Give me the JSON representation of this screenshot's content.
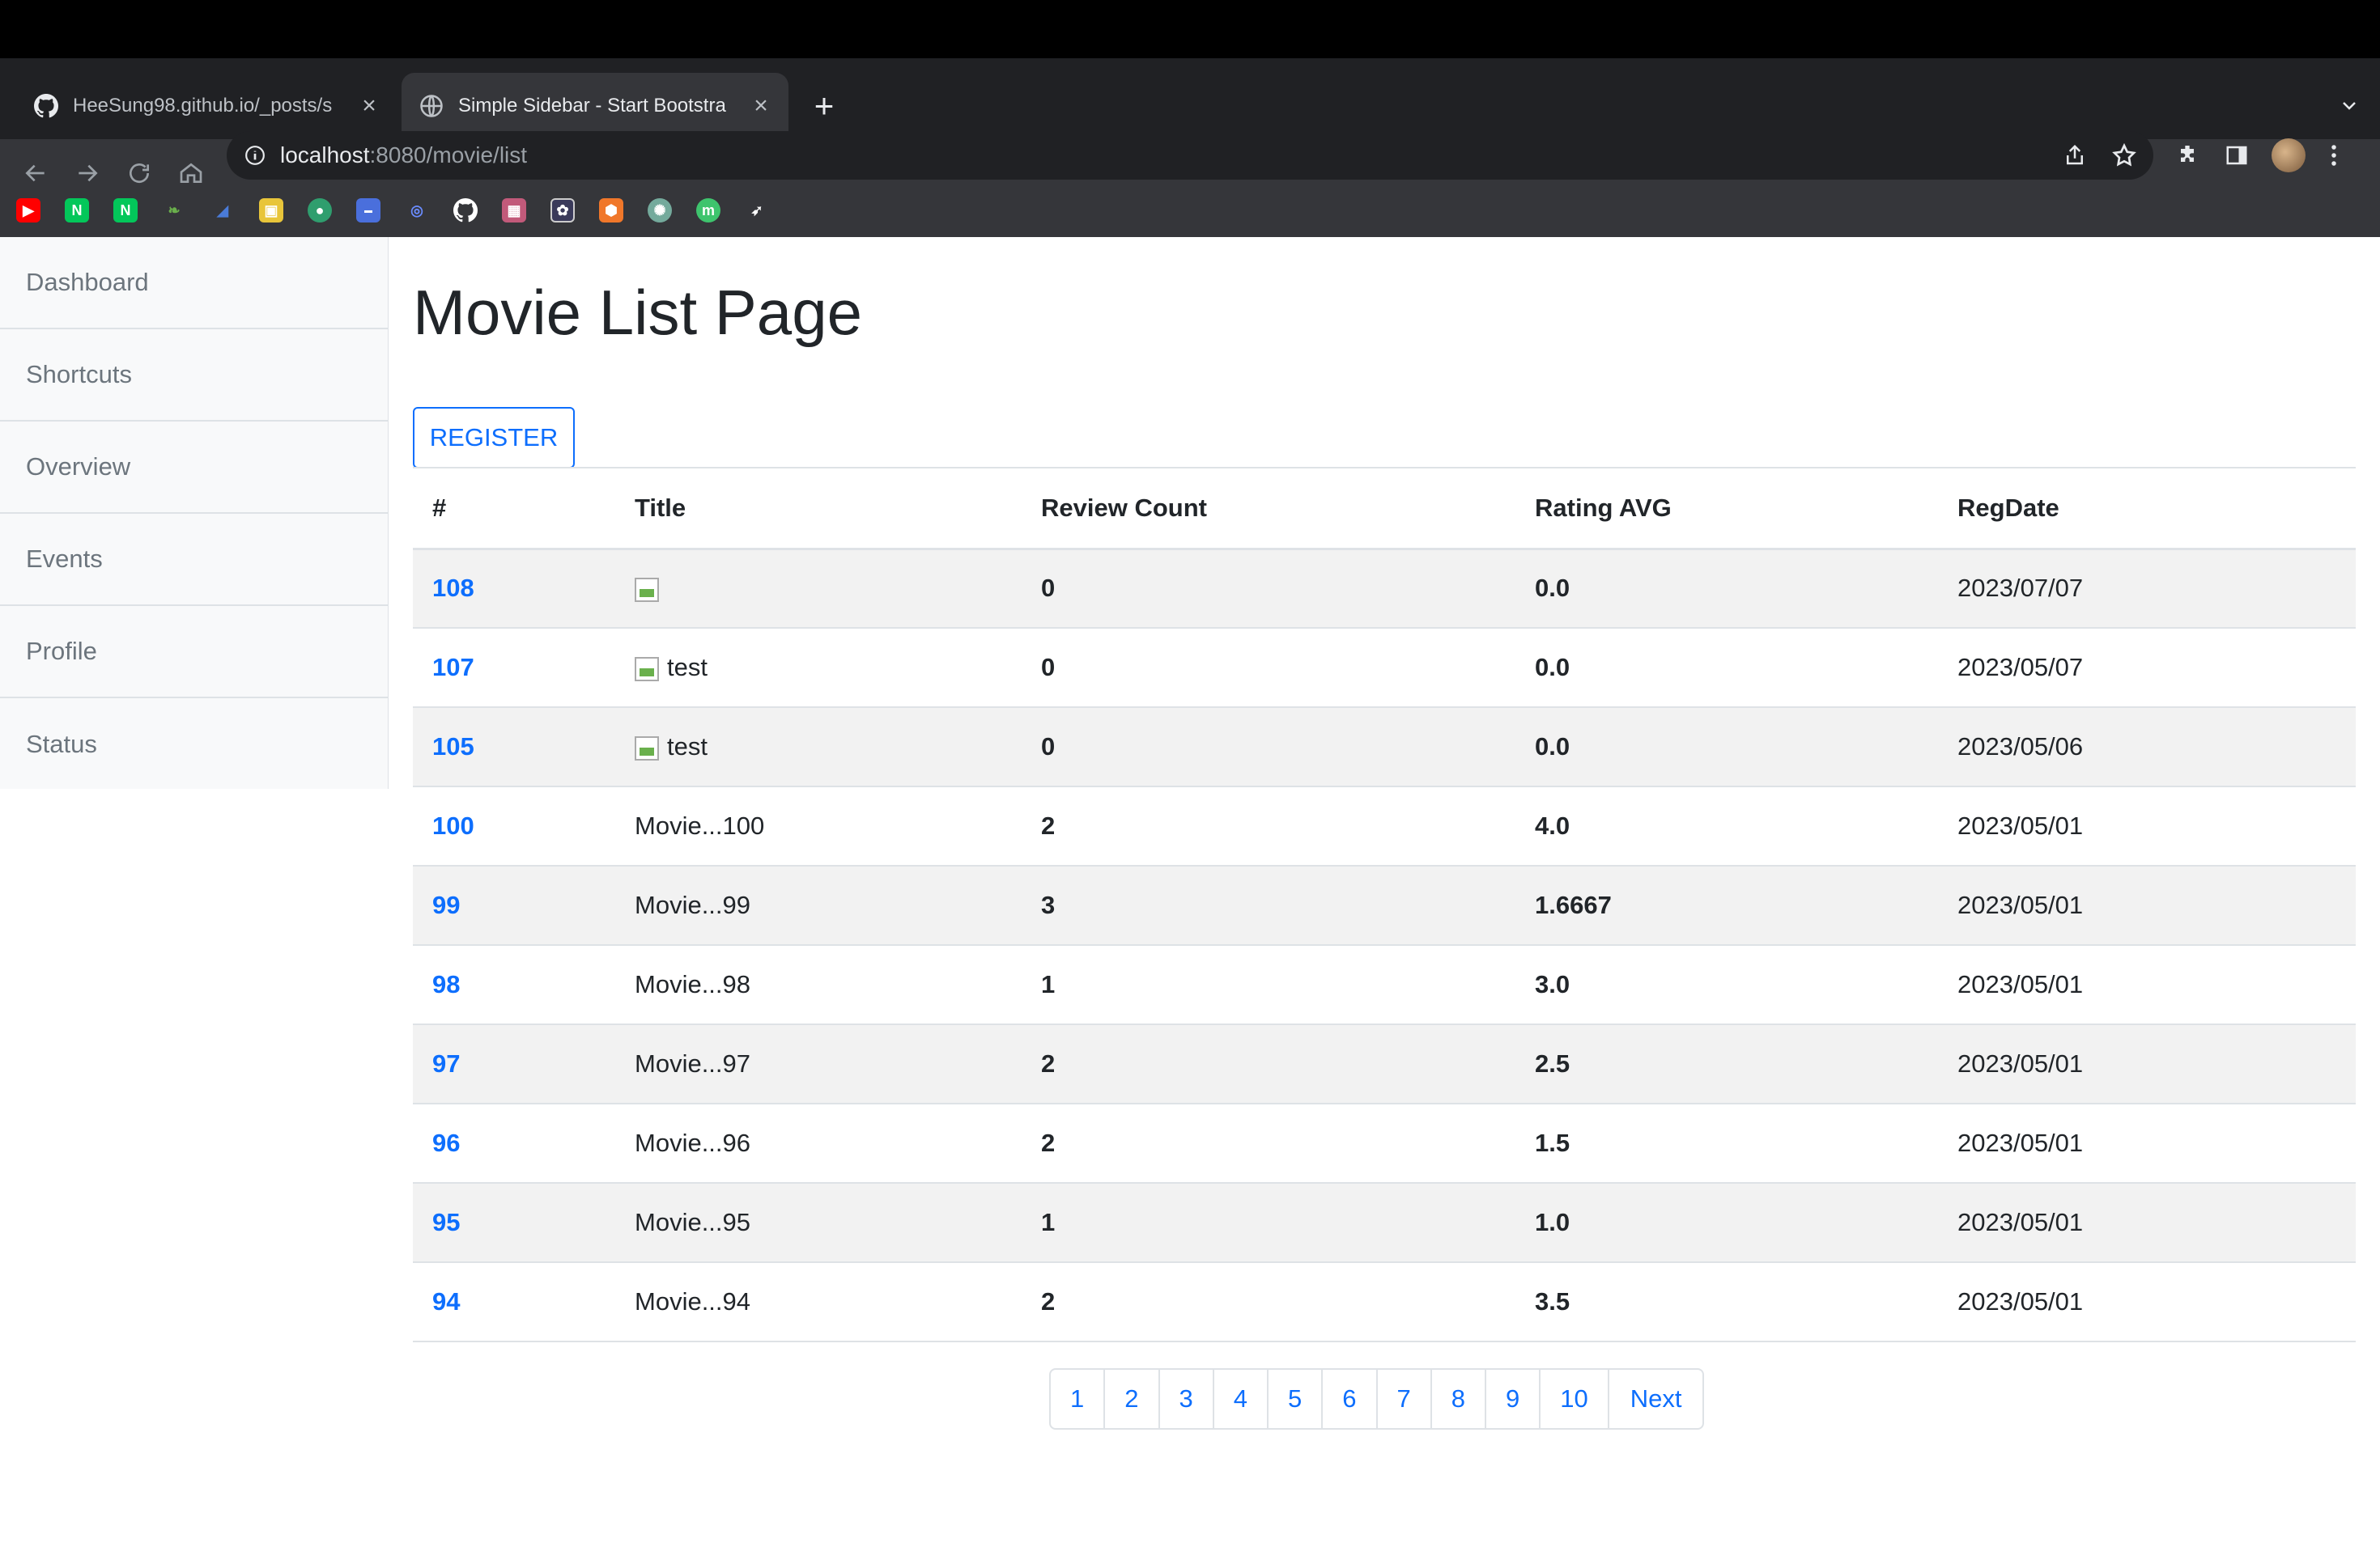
{
  "browser": {
    "tabs": [
      {
        "title": "HeeSung98.github.io/_posts/s",
        "icon": "github-icon"
      },
      {
        "title": "Simple Sidebar - Start Bootstra",
        "icon": "globe-icon"
      }
    ],
    "url_host": "localhost",
    "url_path": ":8080/movie/list"
  },
  "sidebar": {
    "items": [
      {
        "label": "Dashboard"
      },
      {
        "label": "Shortcuts"
      },
      {
        "label": "Overview"
      },
      {
        "label": "Events"
      },
      {
        "label": "Profile"
      },
      {
        "label": "Status"
      }
    ]
  },
  "main": {
    "title": "Movie List Page",
    "register_label": "REGISTER",
    "columns": [
      "#",
      "Title",
      "Review Count",
      "Rating AVG",
      "RegDate"
    ],
    "rows": [
      {
        "id": "108",
        "title": "",
        "has_img": true,
        "reviews": "0",
        "rating": "0.0",
        "date": "2023/07/07"
      },
      {
        "id": "107",
        "title": "test",
        "has_img": true,
        "reviews": "0",
        "rating": "0.0",
        "date": "2023/05/07"
      },
      {
        "id": "105",
        "title": "test",
        "has_img": true,
        "reviews": "0",
        "rating": "0.0",
        "date": "2023/05/06"
      },
      {
        "id": "100",
        "title": "Movie...100",
        "has_img": false,
        "reviews": "2",
        "rating": "4.0",
        "date": "2023/05/01"
      },
      {
        "id": "99",
        "title": "Movie...99",
        "has_img": false,
        "reviews": "3",
        "rating": "1.6667",
        "date": "2023/05/01"
      },
      {
        "id": "98",
        "title": "Movie...98",
        "has_img": false,
        "reviews": "1",
        "rating": "3.0",
        "date": "2023/05/01"
      },
      {
        "id": "97",
        "title": "Movie...97",
        "has_img": false,
        "reviews": "2",
        "rating": "2.5",
        "date": "2023/05/01"
      },
      {
        "id": "96",
        "title": "Movie...96",
        "has_img": false,
        "reviews": "2",
        "rating": "1.5",
        "date": "2023/05/01"
      },
      {
        "id": "95",
        "title": "Movie...95",
        "has_img": false,
        "reviews": "1",
        "rating": "1.0",
        "date": "2023/05/01"
      },
      {
        "id": "94",
        "title": "Movie...94",
        "has_img": false,
        "reviews": "2",
        "rating": "3.5",
        "date": "2023/05/01"
      }
    ],
    "pagination": [
      "1",
      "2",
      "3",
      "4",
      "5",
      "6",
      "7",
      "8",
      "9",
      "10",
      "Next"
    ]
  },
  "colors": {
    "accent": "#0d6efd",
    "chrome_dark": "#202124",
    "chrome_mid": "#35363a"
  }
}
